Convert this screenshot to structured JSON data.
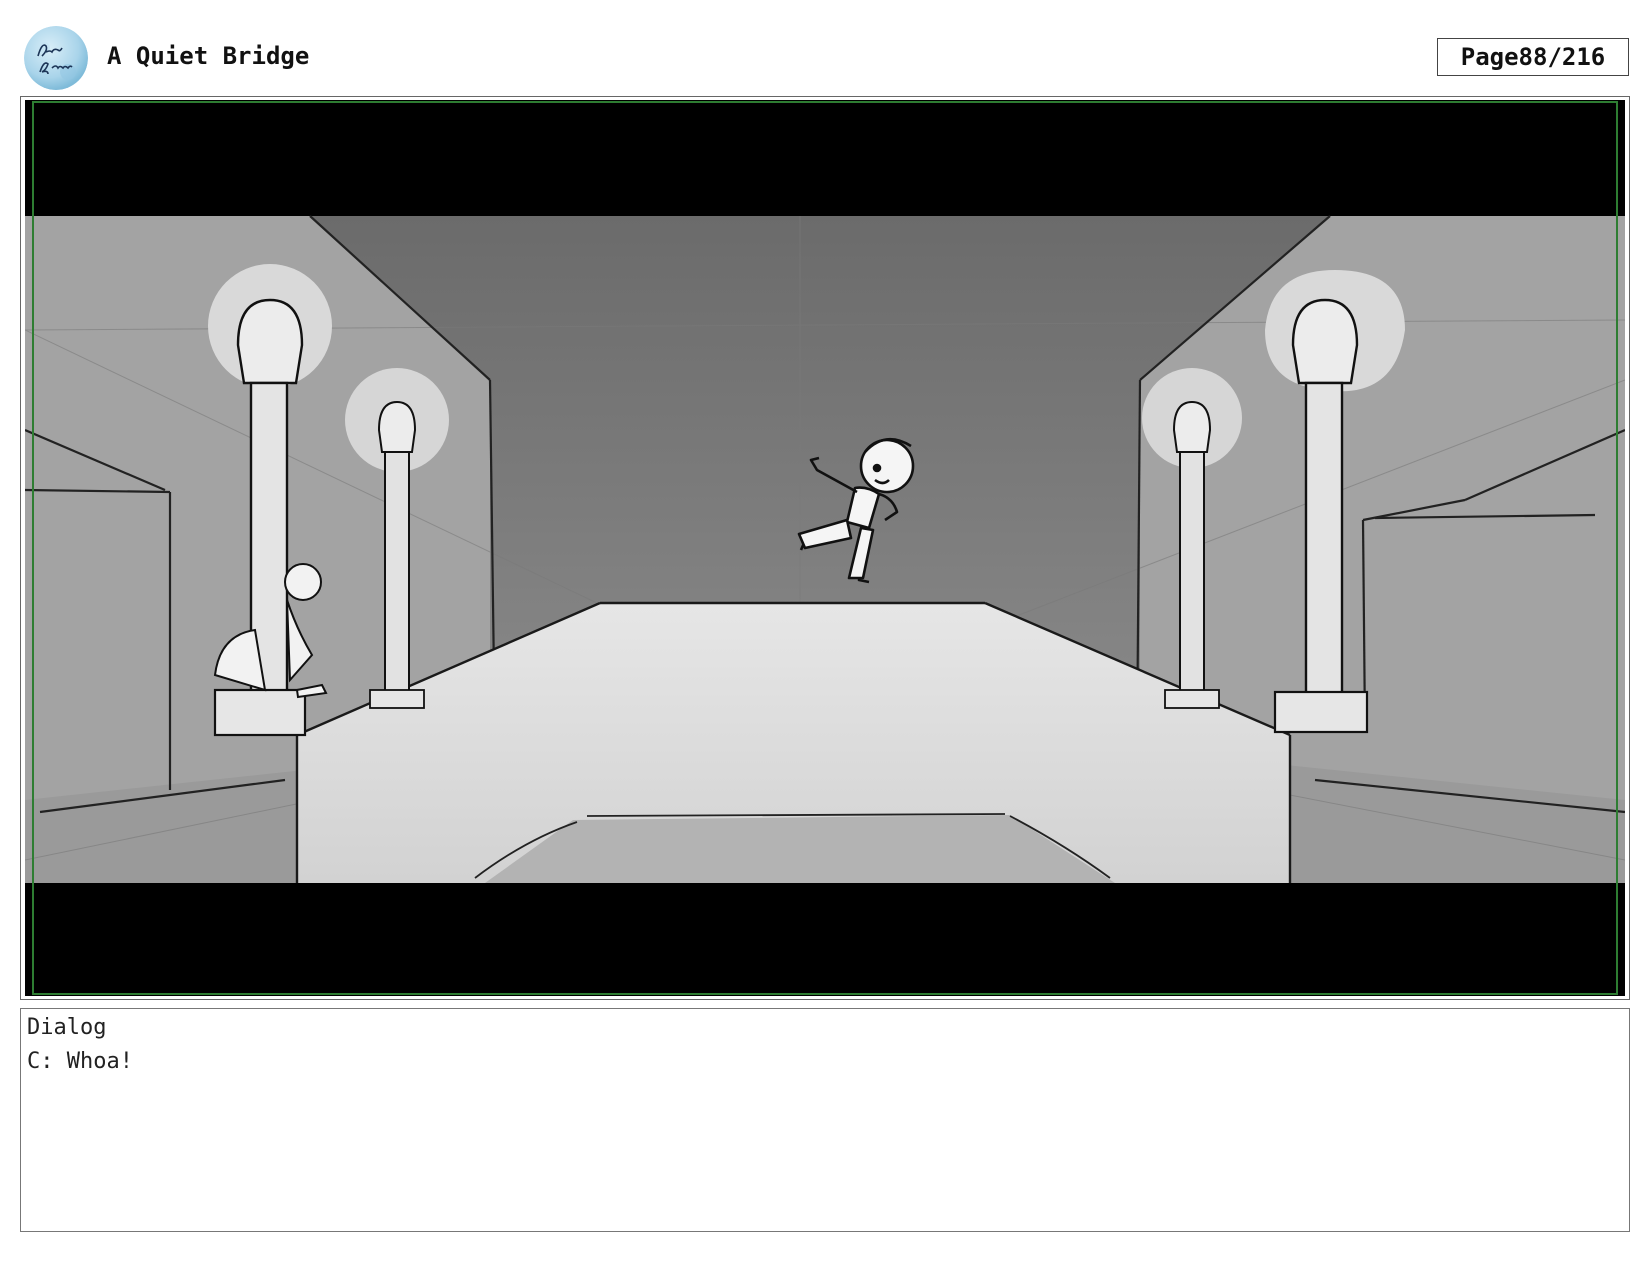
{
  "header": {
    "logo_text": "Anna Brown",
    "title": "A Quiet Bridge",
    "page_label": "Page",
    "page_number": "88/216"
  },
  "panel": {
    "frame_guide_color": "#2e7d32",
    "letterbox_color": "#000000"
  },
  "dialog": {
    "label": "Dialog",
    "line": "C: Whoa!"
  }
}
